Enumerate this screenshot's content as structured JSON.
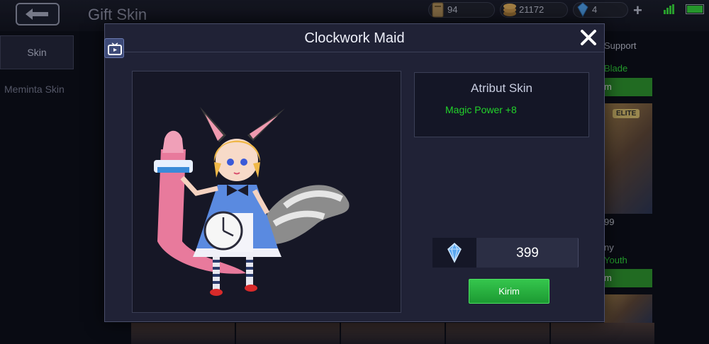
{
  "screen": {
    "title": "Gift Skin",
    "back_icon": "back-arrow-icon"
  },
  "resources": {
    "tickets": "94",
    "battle_points": "21172",
    "diamonds": "4"
  },
  "sidebar": {
    "items": [
      {
        "label": "Skin",
        "active": true
      },
      {
        "label": "Meminta Skin",
        "active": false
      }
    ]
  },
  "background_cards": {
    "category": "Support",
    "item1_name": "Blade",
    "item2_badge": "ELITE",
    "item2_price": "99",
    "item2_hero": "ny",
    "item2_name": "Youth",
    "buy_label": "m"
  },
  "modal": {
    "title": "Clockwork Maid",
    "close_icon": "close-icon",
    "replay_icon": "tv-icon",
    "attributes": {
      "title": "Atribut Skin",
      "items": [
        "Magic Power +8"
      ]
    },
    "price": "399",
    "currency_icon": "diamond-icon",
    "send_label": "Kirim"
  },
  "colors": {
    "accent_green": "#22d32a",
    "button_green": "#2bb542",
    "modal_bg": "#202236"
  }
}
